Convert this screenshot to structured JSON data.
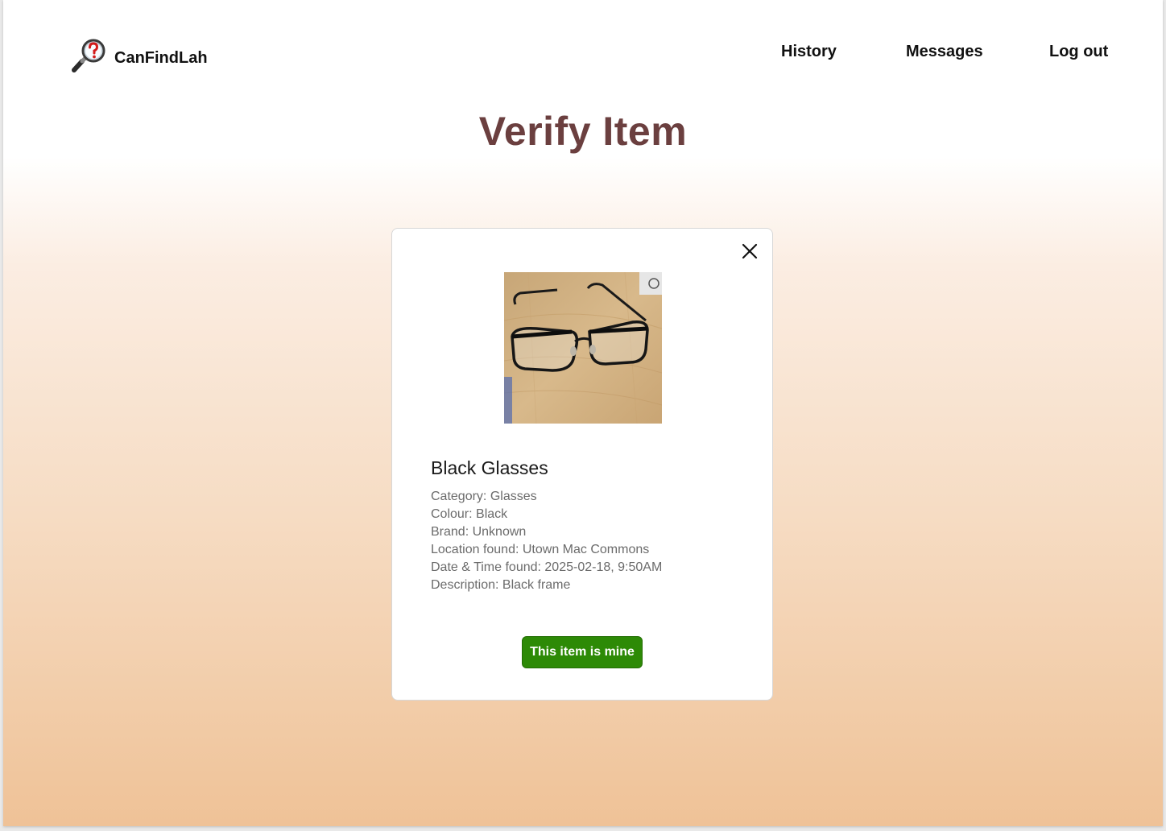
{
  "header": {
    "brand": "CanFindLah",
    "logo_icon": "magnifier-question-icon",
    "nav": {
      "history": "History",
      "messages": "Messages",
      "logout": "Log out"
    }
  },
  "main": {
    "title": "Verify Item"
  },
  "item_card": {
    "close_icon": "close-icon",
    "photo_icon": "glasses-photo",
    "name": "Black Glasses",
    "details": {
      "category": "Category: Glasses",
      "colour": "Colour: Black",
      "brand": "Brand: Unknown",
      "location": "Location found: Utown Mac Commons",
      "datetime": "Date & Time found: 2025-02-18, 9:50AM",
      "description": "Description: Black frame"
    },
    "claim_button": "This item is mine"
  },
  "colors": {
    "title": "#6b3f3f",
    "claim_button": "#2d8a06",
    "gradient_bottom": "#efc297"
  }
}
